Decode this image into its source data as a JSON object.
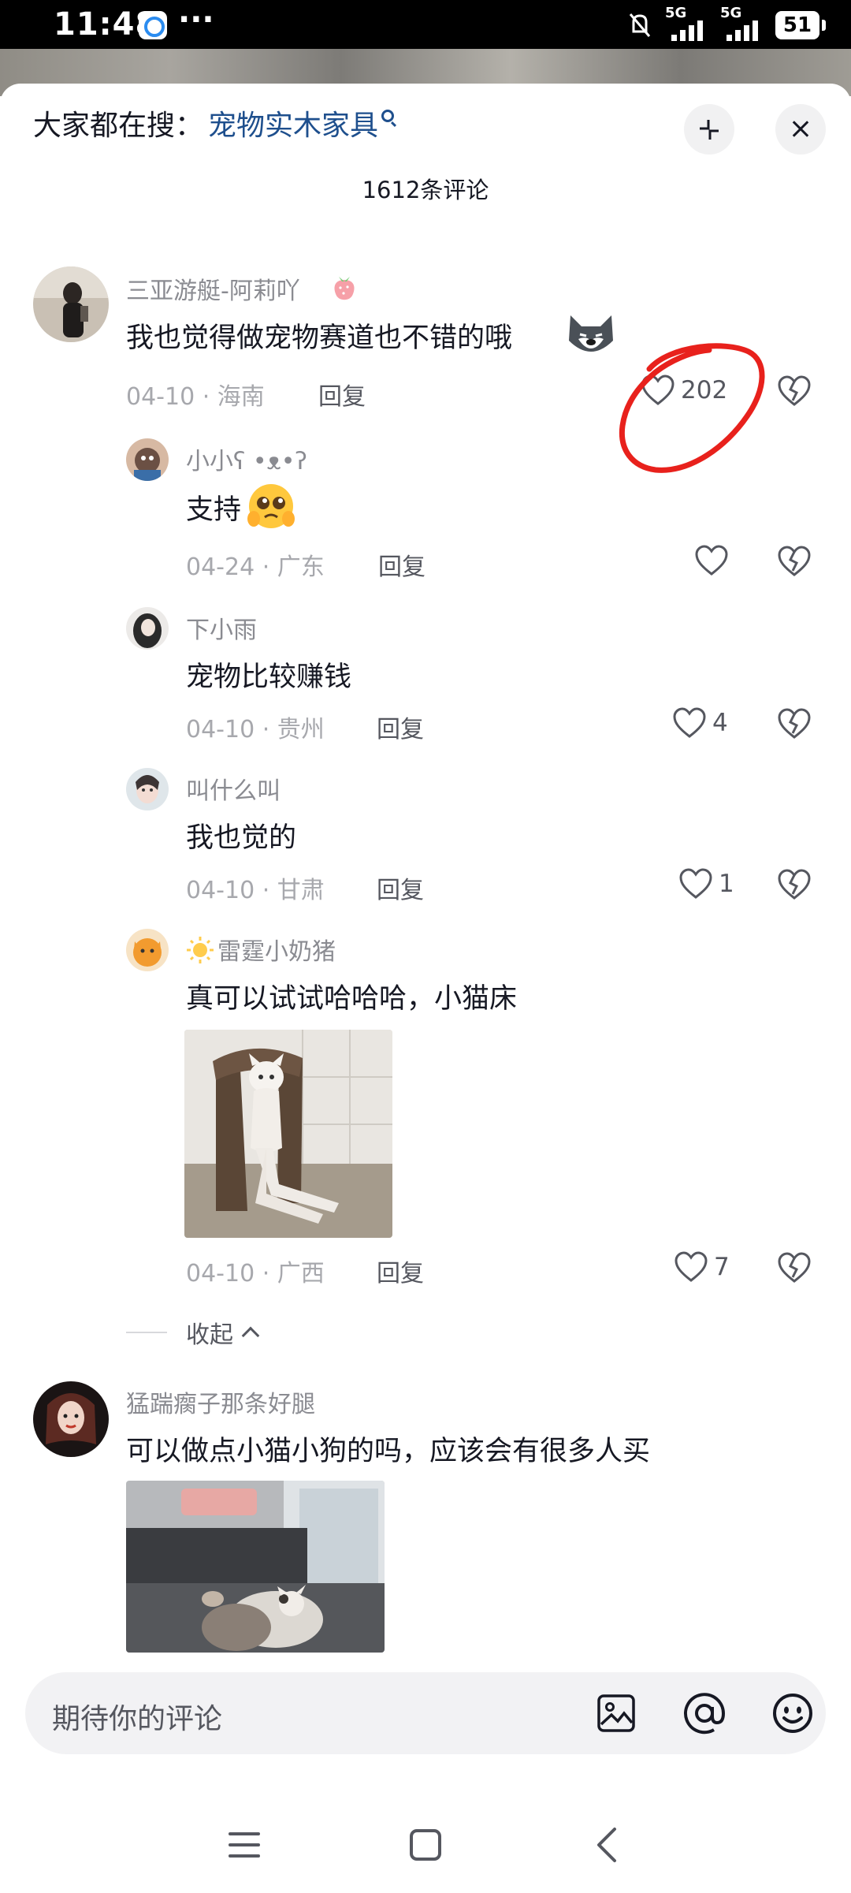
{
  "status_bar": {
    "time": "11:48",
    "dots": "···",
    "signal_1": "5G",
    "signal_2": "5G",
    "battery": "51"
  },
  "header": {
    "search_prefix": "大家都在搜：",
    "search_term": "宠物实木家具",
    "comment_count": "1612条评论"
  },
  "comments": [
    {
      "username": "三亚游艇-阿莉吖",
      "text": "我也觉得做宠物赛道也不错的哦",
      "date": "04-10",
      "location": "海南",
      "reply_label": "回复",
      "likes": "202",
      "avatar_icon": "user-avatar-icon",
      "replies": [
        {
          "username": "小小ʕ •ᴥ•ʔ",
          "text": "支持",
          "date": "04-24",
          "location": "广东",
          "reply_label": "回复",
          "likes": ""
        },
        {
          "username": "下小雨",
          "text": "宠物比较赚钱",
          "date": "04-10",
          "location": "贵州",
          "reply_label": "回复",
          "likes": "4"
        },
        {
          "username": "叫什么叫",
          "text": "我也觉的",
          "date": "04-10",
          "location": "甘肃",
          "reply_label": "回复",
          "likes": "1"
        },
        {
          "username": "雷霆小奶猪",
          "text": "真可以试试哈哈哈，小猫床",
          "date": "04-10",
          "location": "广西",
          "reply_label": "回复",
          "likes": "7",
          "image_icon": "cat-photo"
        }
      ],
      "collapse_label": "收起"
    },
    {
      "username": "猛踹瘸子那条好腿",
      "text": "可以做点小猫小狗的吗，应该会有很多人买",
      "image_icon": "cats-photo"
    }
  ],
  "input": {
    "placeholder": "期待你的评论"
  },
  "icons": {
    "like": "heart-outline-icon",
    "dislike": "broken-heart-icon",
    "image": "image-icon",
    "mention": "at-icon",
    "emoji": "emoji-icon",
    "nav_menu": "menu-icon",
    "nav_home": "square-home-icon",
    "nav_back": "back-chevron-icon"
  },
  "colors": {
    "search_term": "#1e4f8d",
    "annotation": "#e8211c",
    "secondary_text": "#a7a8ad"
  }
}
